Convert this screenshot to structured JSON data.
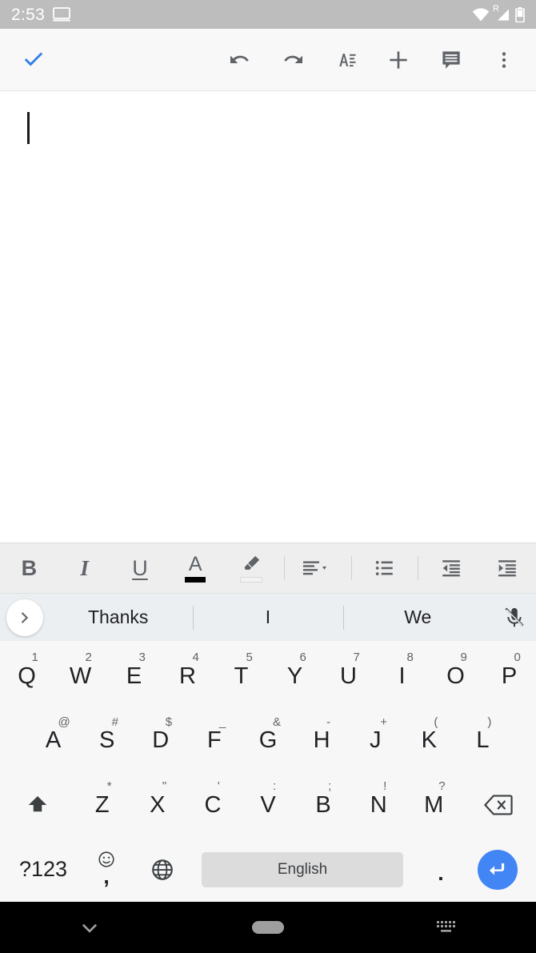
{
  "status_bar": {
    "time": "2:53",
    "icons": {
      "cast": "cast-screen-icon",
      "wifi": "wifi-icon",
      "signal": "cellular-signal-icon",
      "roaming_label": "R",
      "battery": "battery-icon"
    },
    "background_color": "#bdbdbd"
  },
  "app_bar": {
    "done_label": "done-checkmark",
    "accent_color": "#4285f4",
    "actions": [
      {
        "name": "undo-button",
        "label": "Undo"
      },
      {
        "name": "redo-button",
        "label": "Redo"
      },
      {
        "name": "text-format-button",
        "label": "Format"
      },
      {
        "name": "insert-button",
        "label": "Insert"
      },
      {
        "name": "comment-button",
        "label": "Comment"
      },
      {
        "name": "overflow-menu-button",
        "label": "More options"
      }
    ]
  },
  "document": {
    "content": "",
    "caret_visible": true
  },
  "format_bar": {
    "items": [
      {
        "name": "bold-button",
        "label": "B"
      },
      {
        "name": "italic-button",
        "label": "I"
      },
      {
        "name": "underline-button",
        "label": "U"
      },
      {
        "name": "text-color-button",
        "label": "A",
        "swatch_color": "#000000"
      },
      {
        "name": "highlight-button",
        "label": "Highlight",
        "swatch_color": "#f3f3f3"
      },
      {
        "name": "align-button",
        "label": "Align"
      },
      {
        "name": "bullet-list-button",
        "label": "Bulleted list"
      },
      {
        "name": "decrease-indent-button",
        "label": "Decrease indent"
      },
      {
        "name": "increase-indent-button",
        "label": "Increase indent"
      }
    ]
  },
  "suggestion_bar": {
    "expand_label": "expand-suggestions",
    "suggestions": [
      "Thanks",
      "I",
      "We"
    ],
    "mic_label": "voice-input-muted"
  },
  "keyboard": {
    "row1": [
      {
        "key": "Q",
        "alt": "1"
      },
      {
        "key": "W",
        "alt": "2"
      },
      {
        "key": "E",
        "alt": "3"
      },
      {
        "key": "R",
        "alt": "4"
      },
      {
        "key": "T",
        "alt": "5"
      },
      {
        "key": "Y",
        "alt": "6"
      },
      {
        "key": "U",
        "alt": "7"
      },
      {
        "key": "I",
        "alt": "8"
      },
      {
        "key": "O",
        "alt": "9"
      },
      {
        "key": "P",
        "alt": "0"
      }
    ],
    "row2": [
      {
        "key": "A",
        "alt": "@"
      },
      {
        "key": "S",
        "alt": "#"
      },
      {
        "key": "D",
        "alt": "$"
      },
      {
        "key": "F",
        "alt": "_"
      },
      {
        "key": "G",
        "alt": "&"
      },
      {
        "key": "H",
        "alt": "-"
      },
      {
        "key": "J",
        "alt": "+"
      },
      {
        "key": "K",
        "alt": "("
      },
      {
        "key": "L",
        "alt": ")"
      }
    ],
    "row3": [
      {
        "key": "Z",
        "alt": "*"
      },
      {
        "key": "X",
        "alt": "\""
      },
      {
        "key": "C",
        "alt": "'"
      },
      {
        "key": "V",
        "alt": ":"
      },
      {
        "key": "B",
        "alt": ";"
      },
      {
        "key": "N",
        "alt": "!"
      },
      {
        "key": "M",
        "alt": "?"
      }
    ],
    "shift_label": "shift-key",
    "backspace_label": "backspace-key",
    "row4": {
      "symbols_label": "?123",
      "comma_label": ",",
      "emoji_label": "emoji-key",
      "globe_label": "language-switch",
      "space_label": "English",
      "period_label": ".",
      "enter_label": "enter-key",
      "enter_color": "#4285f4"
    }
  },
  "nav_bar": {
    "back_label": "hide-keyboard-chevron",
    "home_label": "home-pill",
    "keyboard_switch_label": "keyboard-switcher-icon",
    "background_color": "#000000"
  }
}
